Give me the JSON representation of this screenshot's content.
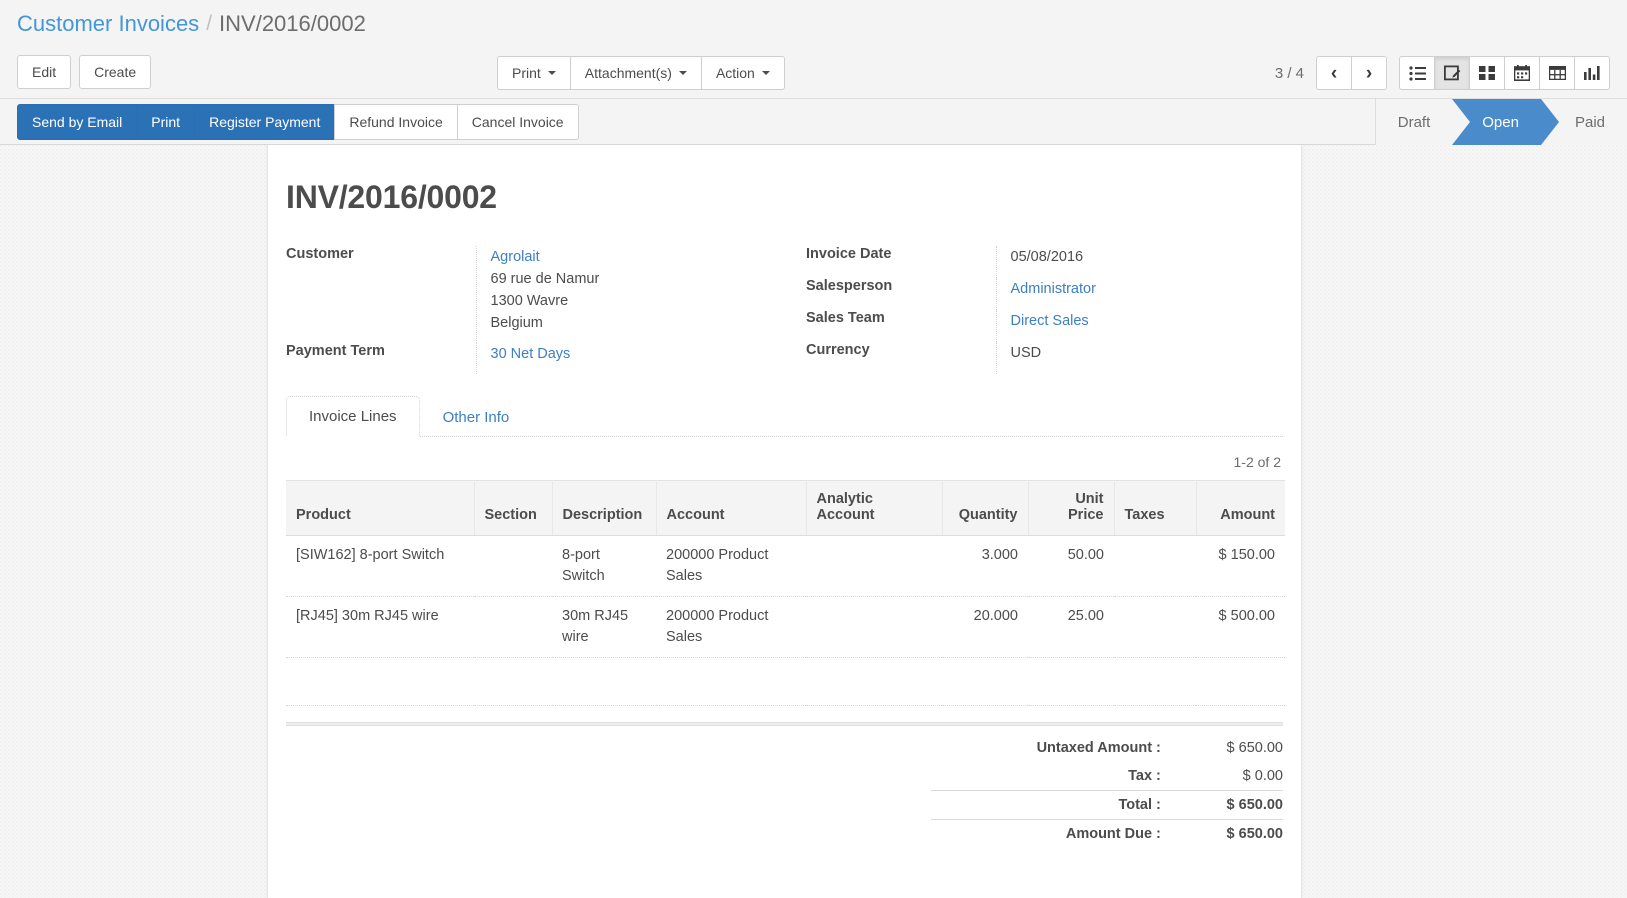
{
  "breadcrumb": {
    "root": "Customer Invoices",
    "separator": "/",
    "current": "INV/2016/0002"
  },
  "control_panel": {
    "edit_label": "Edit",
    "create_label": "Create",
    "print_label": "Print",
    "attachments_label": "Attachment(s)",
    "action_label": "Action",
    "pager_text": "3 / 4",
    "prev_icon": "chevron-left-icon",
    "next_icon": "chevron-right-icon",
    "views": [
      {
        "icon": "list-view-icon",
        "active": false
      },
      {
        "icon": "form-view-icon",
        "active": true
      },
      {
        "icon": "kanban-view-icon",
        "active": false
      },
      {
        "icon": "calendar-view-icon",
        "active": false
      },
      {
        "icon": "pivot-view-icon",
        "active": false
      },
      {
        "icon": "graph-view-icon",
        "active": false
      }
    ]
  },
  "statusbar": {
    "buttons": [
      {
        "label": "Send by Email",
        "primary": true
      },
      {
        "label": "Print",
        "primary": true
      },
      {
        "label": "Register Payment",
        "primary": true
      },
      {
        "label": "Refund Invoice",
        "primary": false
      },
      {
        "label": "Cancel Invoice",
        "primary": false
      }
    ],
    "stages": [
      {
        "label": "Draft",
        "state": "done"
      },
      {
        "label": "Open",
        "state": "active"
      },
      {
        "label": "Paid",
        "state": "future"
      }
    ],
    "active_color": "#4a8ccb"
  },
  "form": {
    "title": "INV/2016/0002",
    "left_fields": {
      "customer_label": "Customer",
      "customer_name": "Agrolait",
      "customer_street": "69 rue de Namur",
      "customer_city": "1300 Wavre",
      "customer_country": "Belgium",
      "payment_term_label": "Payment Term",
      "payment_term_value": "30 Net Days"
    },
    "right_fields": {
      "invoice_date_label": "Invoice Date",
      "invoice_date_value": "05/08/2016",
      "salesperson_label": "Salesperson",
      "salesperson_value": "Administrator",
      "sales_team_label": "Sales Team",
      "sales_team_value": "Direct Sales",
      "currency_label": "Currency",
      "currency_value": "USD"
    },
    "tabs": [
      {
        "label": "Invoice Lines",
        "active": true
      },
      {
        "label": "Other Info",
        "active": false
      }
    ],
    "lines_pager": "1-2 of 2",
    "lines_table": {
      "headers": [
        "Product",
        "Section",
        "Description",
        "Account",
        "Analytic Account",
        "Quantity",
        "Unit Price",
        "Taxes",
        "Amount"
      ],
      "rows": [
        {
          "product": "[SIW162] 8-port Switch",
          "section": "",
          "description": "8-port Switch",
          "account": "200000 Product Sales",
          "analytic_account": "",
          "quantity": "3.000",
          "unit_price": "50.00",
          "taxes": "",
          "amount": "$ 150.00"
        },
        {
          "product": "[RJ45] 30m RJ45 wire",
          "section": "",
          "description": "30m RJ45 wire",
          "account": "200000 Product Sales",
          "analytic_account": "",
          "quantity": "20.000",
          "unit_price": "25.00",
          "taxes": "",
          "amount": "$ 500.00"
        }
      ]
    },
    "totals": {
      "untaxed_label": "Untaxed Amount :",
      "untaxed_value": "$ 650.00",
      "tax_label": "Tax :",
      "tax_value": "$ 0.00",
      "total_label": "Total :",
      "total_value": "$ 650.00",
      "due_label": "Amount Due :",
      "due_value": "$ 650.00"
    }
  }
}
